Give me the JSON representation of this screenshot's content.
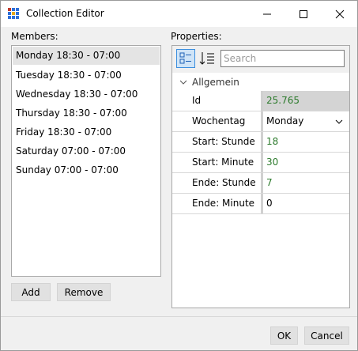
{
  "window": {
    "title": "Collection Editor"
  },
  "members": {
    "label": "Members:",
    "items": [
      "Monday 18:30 - 07:00",
      "Tuesday 18:30 - 07:00",
      "Wednesday 18:30 - 07:00",
      "Thursday 18:30 - 07:00",
      "Friday 18:30 - 07:00",
      "Saturday 07:00 - 07:00",
      "Sunday 07:00 - 07:00"
    ],
    "add_label": "Add",
    "remove_label": "Remove"
  },
  "properties": {
    "label": "Properties:",
    "search_placeholder": "Search",
    "category": "Allgemein",
    "rows": [
      {
        "name": "Id",
        "value": "25.765"
      },
      {
        "name": "Wochentag",
        "value": "Monday"
      },
      {
        "name": "Start: Stunde",
        "value": "18"
      },
      {
        "name": "Start: Minute",
        "value": "30"
      },
      {
        "name": "Ende: Stunde",
        "value": "7"
      },
      {
        "name": "Ende: Minute",
        "value": "0"
      }
    ]
  },
  "footer": {
    "ok_label": "OK",
    "cancel_label": "Cancel"
  },
  "colors": {
    "numeric_value": "#2d7b2d",
    "selection": "#e4e4e4",
    "accent": "#3b8ede"
  }
}
